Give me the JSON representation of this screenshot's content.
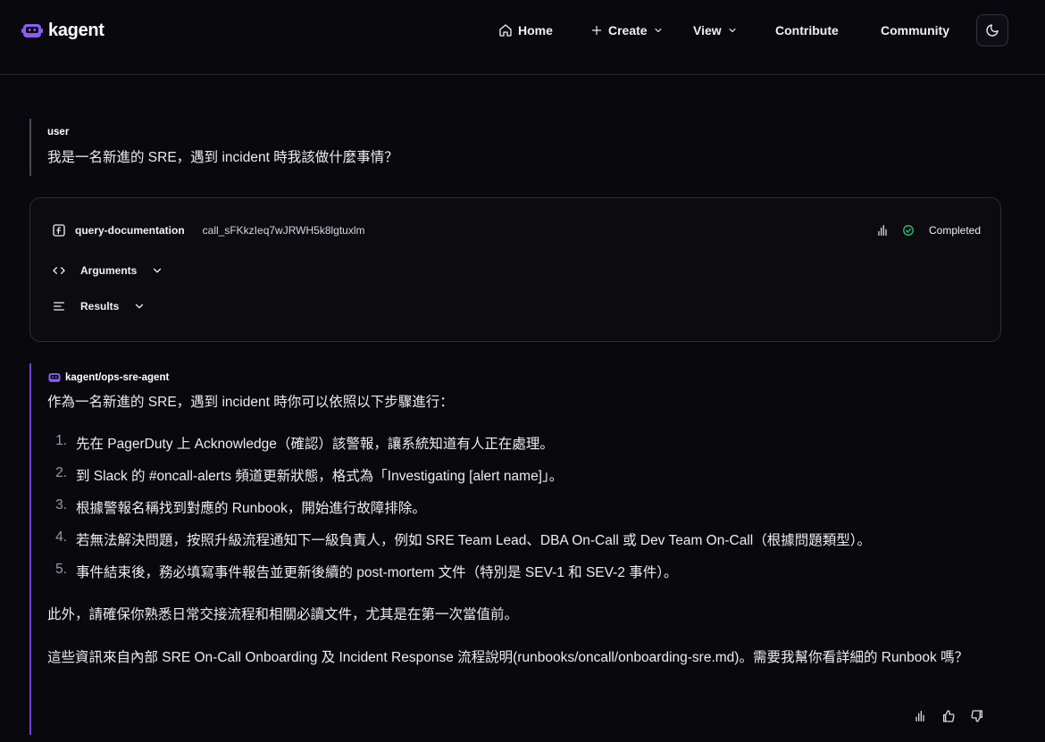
{
  "header": {
    "brand": "kagent",
    "nav": {
      "home": "Home",
      "create": "Create",
      "view": "View",
      "contribute": "Contribute",
      "community": "Community"
    }
  },
  "user_message": {
    "role": "user",
    "text": "我是一名新進的 SRE，遇到 incident 時我該做什麼事情？"
  },
  "tool_call": {
    "name": "query-documentation",
    "call_id": "call_sFKkzIeq7wJRWH5k8lgtuxlm",
    "status": "Completed",
    "arguments_label": "Arguments",
    "results_label": "Results"
  },
  "agent_message": {
    "role": "kagent/ops-sre-agent",
    "intro": "作為一名新進的 SRE，遇到 incident 時你可以依照以下步驟進行：",
    "steps": [
      {
        "num": "1.",
        "text": "先在 PagerDuty 上 Acknowledge（確認）該警報，讓系統知道有人正在處理。"
      },
      {
        "num": "2.",
        "text": "到 Slack 的 #oncall-alerts 頻道更新狀態，格式為「Investigating [alert name]」。"
      },
      {
        "num": "3.",
        "text": "根據警報名稱找到對應的 Runbook，開始進行故障排除。"
      },
      {
        "num": "4.",
        "text": "若無法解決問題，按照升級流程通知下一級負責人，例如 SRE Team Lead、DBA On-Call 或 Dev Team On-Call（根據問題類型）。"
      },
      {
        "num": "5.",
        "text": "事件結束後，務必填寫事件報告並更新後續的 post-mortem 文件（特別是 SEV-1 和 SEV-2 事件）。"
      }
    ],
    "para1": "此外，請確保你熟悉日常交接流程和相關必讀文件，尤其是在第一次當值前。",
    "para2": "這些資訊來自內部 SRE On-Call Onboarding 及 Incident Response 流程說明(runbooks/oncall/onboarding-sre.md)。需要我幫你看詳細的 Runbook 嗎？"
  },
  "colors": {
    "background": "#08080d",
    "accent": "#6f45d8",
    "success": "#2fb56a"
  }
}
